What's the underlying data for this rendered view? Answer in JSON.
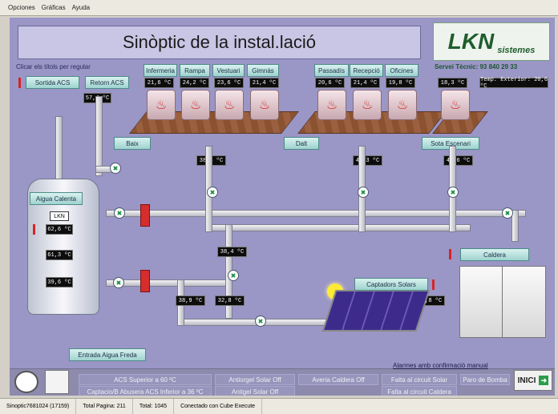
{
  "menu": [
    "Opciones",
    "Gráficas",
    "Ayuda"
  ],
  "title": "Sinòptic de la instal.lació",
  "logo": {
    "brand": "LKN",
    "sub": "sistemes"
  },
  "hint": "Clicar els títols per regular",
  "service_text": "Servei Tècnic: 93 840 29 33",
  "left_controls": {
    "sortida": "Sortida ACS",
    "retorn": "Retorn ACS",
    "retorn_value": "57,4 ºC"
  },
  "rooms_left": [
    {
      "label": "Infermeria",
      "temp": "21,6 ºC"
    },
    {
      "label": "Rampa",
      "temp": "24,2 ºC"
    },
    {
      "label": "Vestuari",
      "temp": "23,6 ºC"
    },
    {
      "label": "Gimnàs",
      "temp": "21,4 ºC"
    }
  ],
  "rooms_right": [
    {
      "label": "Passadís",
      "temp": "20,6 ºC"
    },
    {
      "label": "Recepció",
      "temp": "21,4 ºC"
    },
    {
      "label": "Oficines",
      "temp": "19,8 ºC"
    }
  ],
  "single_room": {
    "temp": "18,3 ºC"
  },
  "outdoor": "Temp. Exterior: 20,6 ºC",
  "zones": {
    "baix": "Baix",
    "dalt": "Dalt",
    "sota": "Sota Escenari"
  },
  "zone_temps": {
    "baix": "38,4 ºC",
    "dalt": "42,3 ºC",
    "sota": "49,6 ºC"
  },
  "tank": {
    "label": "Aigua Calenta",
    "brand": "LKN",
    "temps": [
      "62,6 ºC",
      "61,3 ºC",
      "39,6 ºC"
    ]
  },
  "middle_temps": {
    "return": "38,4 ºC",
    "solar_in": "38,9 ºC",
    "solar_out": "32,8 ºC",
    "panel": "28,8 ºC"
  },
  "solar": "Captadors Solars",
  "caldera": "Caldera",
  "entrada": "Entrada Aigua Freda",
  "alarms_title": "Alarmes amb confirmació manual",
  "alarms": [
    "ACS Superior a 60 ºC",
    "Antiorgel Solar Off",
    "Averia Caldera Off",
    "Falta al circuit Solar",
    "Falta al circuit Caldera",
    "Paro de Bomba",
    "Captacio/B Abusera ACS Inferior a 36 ºC",
    "Antigel Solar Off"
  ],
  "inici": "INICI",
  "status": [
    "Sinoptic7681024 (17159)",
    "Total Pagina: 211",
    "Total: 1045",
    "Conectado con Cube Execute"
  ]
}
